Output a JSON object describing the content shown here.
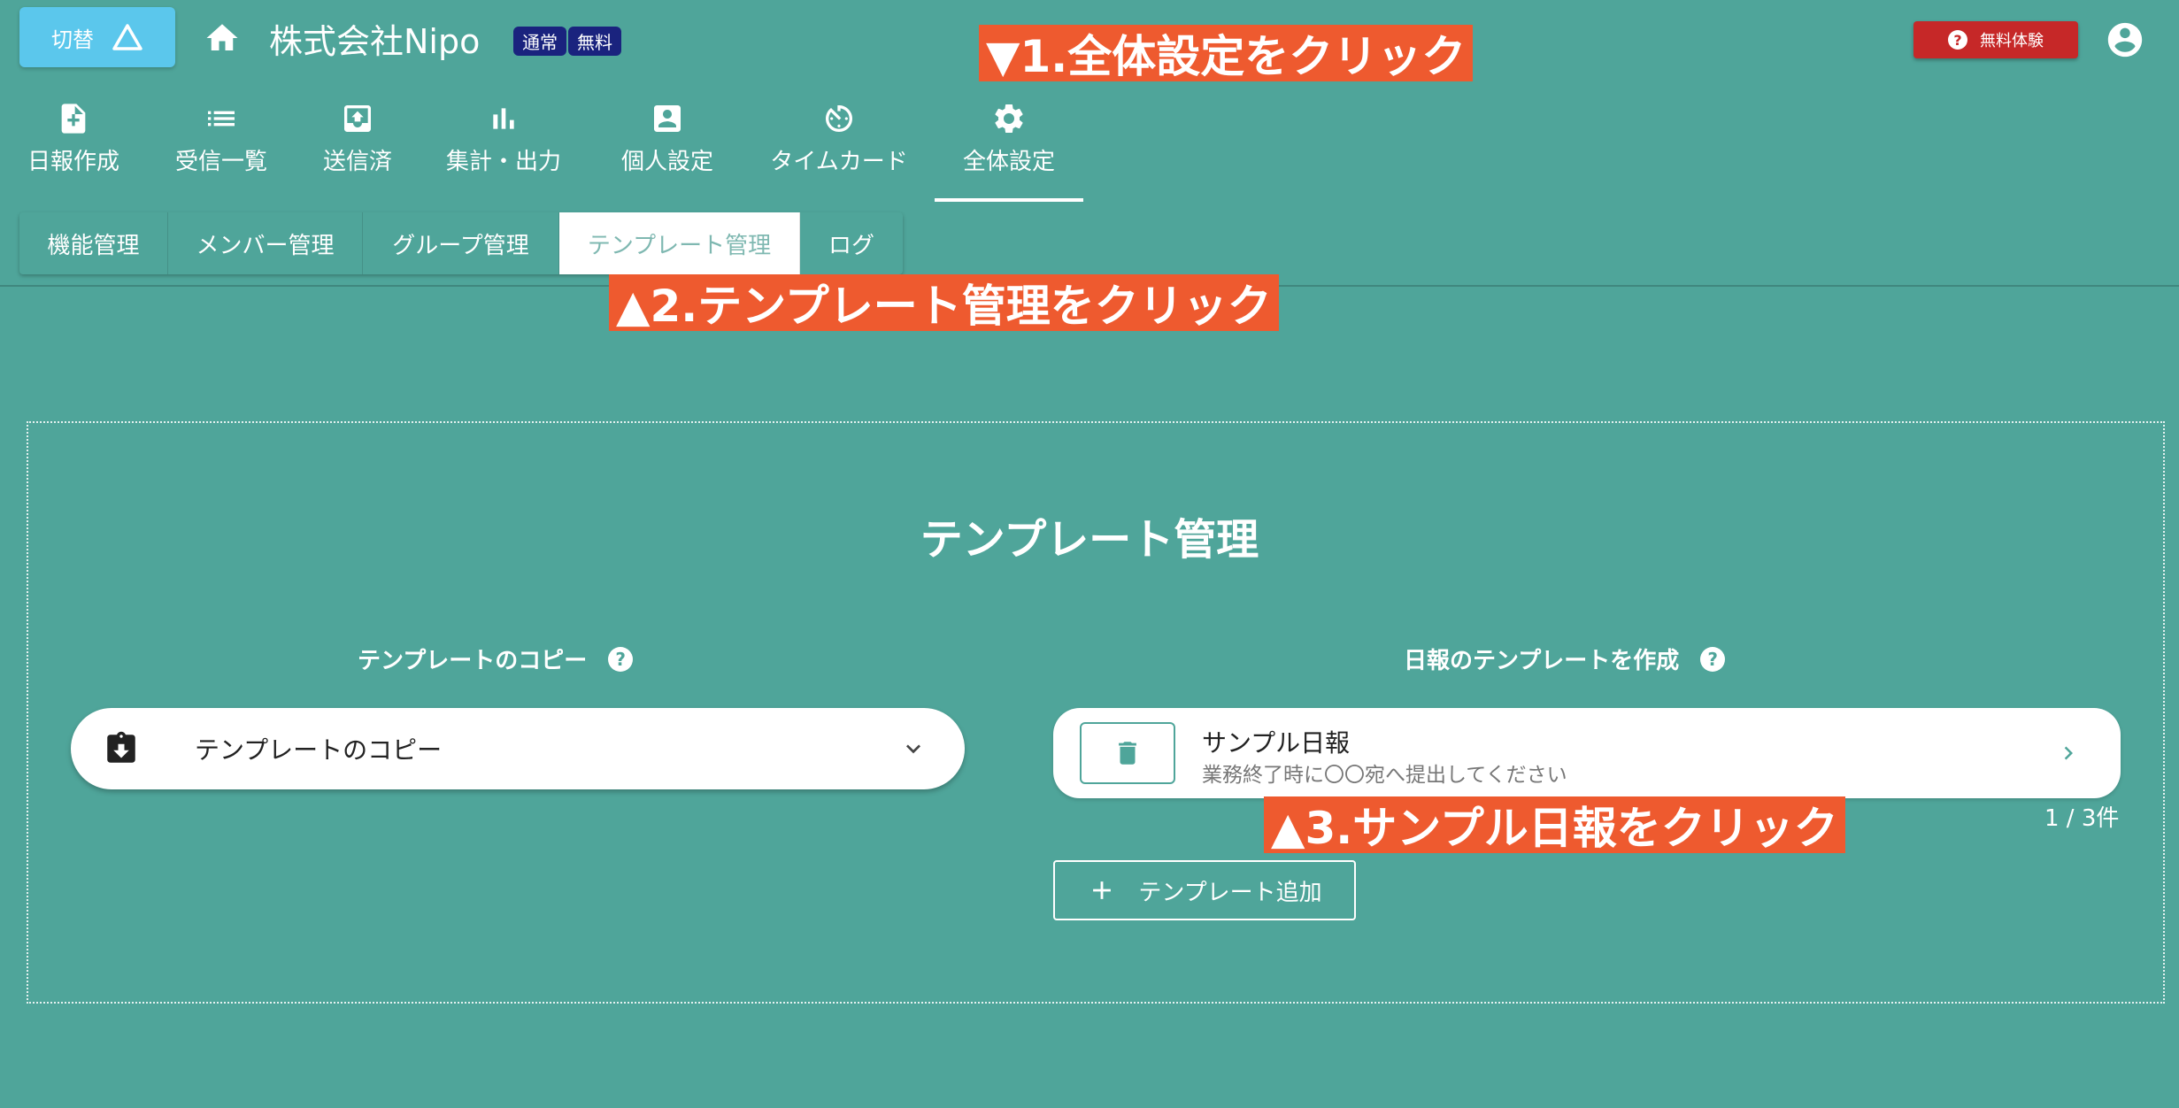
{
  "header": {
    "switch_label": "切替",
    "company_name": "株式会社Nipo",
    "badges": [
      "通常",
      "無料"
    ],
    "trial_label": "無料体験"
  },
  "nav": {
    "items": [
      {
        "label": "日報作成",
        "icon": "file-plus-icon"
      },
      {
        "label": "受信一覧",
        "icon": "list-icon"
      },
      {
        "label": "送信済",
        "icon": "outbox-icon"
      },
      {
        "label": "集計・出力",
        "icon": "bar-chart-icon"
      },
      {
        "label": "個人設定",
        "icon": "account-box-icon"
      },
      {
        "label": "タイムカード",
        "icon": "timer-icon"
      },
      {
        "label": "全体設定",
        "icon": "gear-icon"
      }
    ],
    "active": "全体設定"
  },
  "subtabs": {
    "items": [
      "機能管理",
      "メンバー管理",
      "グループ管理",
      "テンプレート管理",
      "ログ"
    ],
    "active": "テンプレート管理"
  },
  "annotations": {
    "step1": "▼1.全体設定をクリック",
    "step2": "▲2.テンプレート管理をクリック",
    "step3": "▲3.サンプル日報をクリック"
  },
  "main": {
    "title": "テンプレート管理",
    "copy_section": {
      "label": "テンプレートのコピー",
      "select_value": "テンプレートのコピー"
    },
    "create_section": {
      "label": "日報のテンプレートを作成",
      "templates": [
        {
          "name": "サンプル日報",
          "description": "業務終了時に〇〇宛へ提出してください"
        }
      ],
      "count": "1 / 3件",
      "add_label": "テンプレート追加"
    }
  },
  "colors": {
    "background": "#4fa59a",
    "switch_button": "#5bc7ec",
    "trial_button": "#c62828",
    "badge": "#1a237e",
    "annotation": "#ee5a2f"
  }
}
